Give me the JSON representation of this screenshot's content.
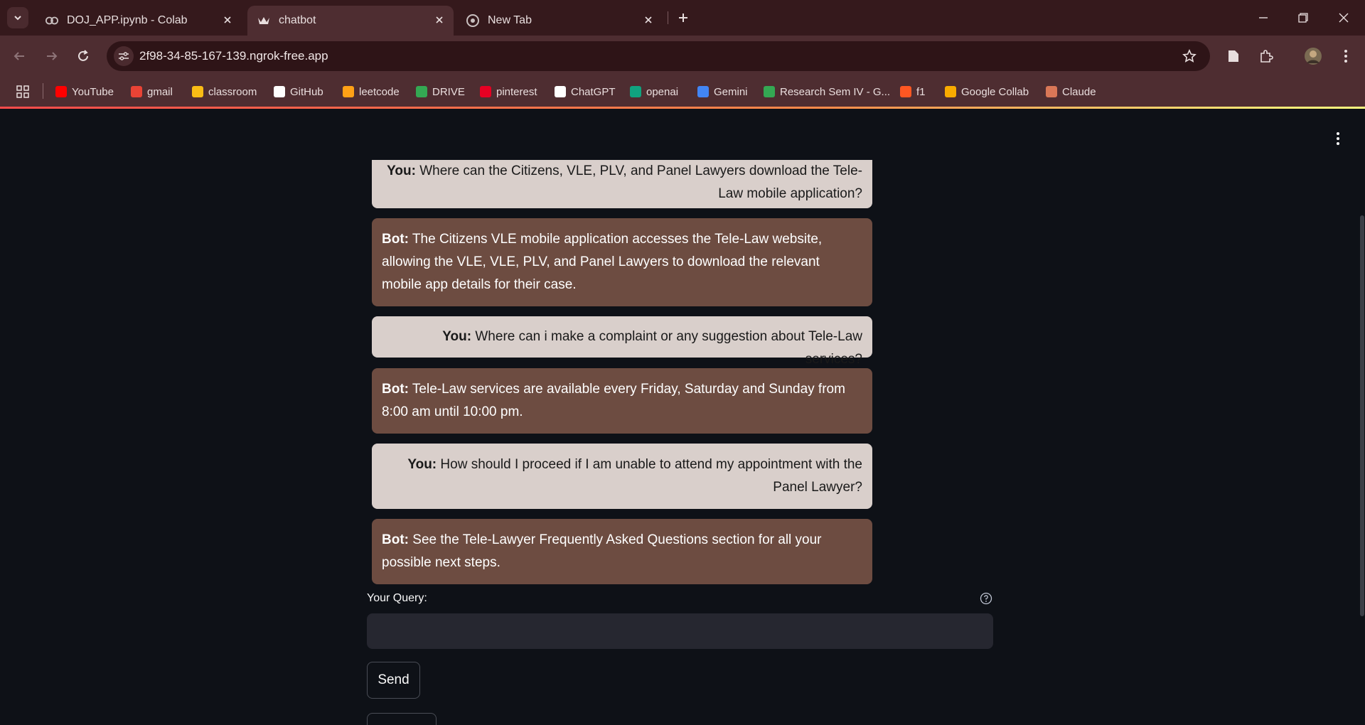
{
  "browser": {
    "tabs": [
      {
        "title": "DOJ_APP.ipynb - Colab",
        "icon": "colab-icon"
      },
      {
        "title": "chatbot",
        "icon": "streamlit-crown-icon"
      },
      {
        "title": "New Tab",
        "icon": "chrome-icon"
      }
    ],
    "url": "2f98-34-85-167-139.ngrok-free.app",
    "bookmarks": [
      {
        "label": "YouTube",
        "icon": "youtube-icon",
        "color": "#ff0000"
      },
      {
        "label": "gmail",
        "icon": "gmail-icon",
        "color": "#ea4335"
      },
      {
        "label": "classroom",
        "icon": "classroom-icon",
        "color": "#f9bc15"
      },
      {
        "label": "GitHub",
        "icon": "github-icon",
        "color": "#ffffff"
      },
      {
        "label": "leetcode",
        "icon": "leetcode-icon",
        "color": "#ffa116"
      },
      {
        "label": "DRIVE",
        "icon": "drive-icon",
        "color": "#34a853"
      },
      {
        "label": "pinterest",
        "icon": "pinterest-icon",
        "color": "#e60023"
      },
      {
        "label": "ChatGPT",
        "icon": "chatgpt-icon",
        "color": "#ffffff"
      },
      {
        "label": "openai",
        "icon": "openai-icon",
        "color": "#10a37f"
      },
      {
        "label": "Gemini",
        "icon": "gemini-icon",
        "color": "#4285f4"
      },
      {
        "label": "Research Sem IV - G...",
        "icon": "drive-icon",
        "color": "#34a853"
      },
      {
        "label": "f1",
        "icon": "fc-icon",
        "color": "#ff5722"
      },
      {
        "label": "Google Collab",
        "icon": "colab-icon",
        "color": "#f9ab00"
      },
      {
        "label": "Claude",
        "icon": "claude-icon",
        "color": "#d97757"
      }
    ]
  },
  "chat": {
    "messages": [
      {
        "role": "You",
        "text": "Where can the Citizens, VLE, PLV, and Panel Lawyers download the Tele-Law mobile application?"
      },
      {
        "role": "Bot",
        "text": "The Citizens VLE mobile application accesses the Tele-Law website, allowing the VLE, VLE, PLV, and Panel Lawyers to download the relevant mobile app details for their case."
      },
      {
        "role": "You",
        "text": "Where can i make a complaint or any suggestion about Tele-Law services?"
      },
      {
        "role": "Bot",
        "text": "Tele-Law services are available every Friday, Saturday and Sunday from 8:00 am until 10:00 pm."
      },
      {
        "role": "You",
        "text": "How should I proceed if I am unable to attend my appointment with the Panel Lawyer?"
      },
      {
        "role": "Bot",
        "text": "See the Tele-Lawyer Frequently Asked Questions section for all your possible next steps."
      }
    ],
    "speaker_you": "You:",
    "speaker_bot": "Bot:"
  },
  "form": {
    "query_label": "Your Query:",
    "query_value": "",
    "send_label": "Send"
  },
  "colors": {
    "user_bubble": "#d9cfcb",
    "bot_bubble": "#6d4c41",
    "page_bg": "#0e1117"
  }
}
